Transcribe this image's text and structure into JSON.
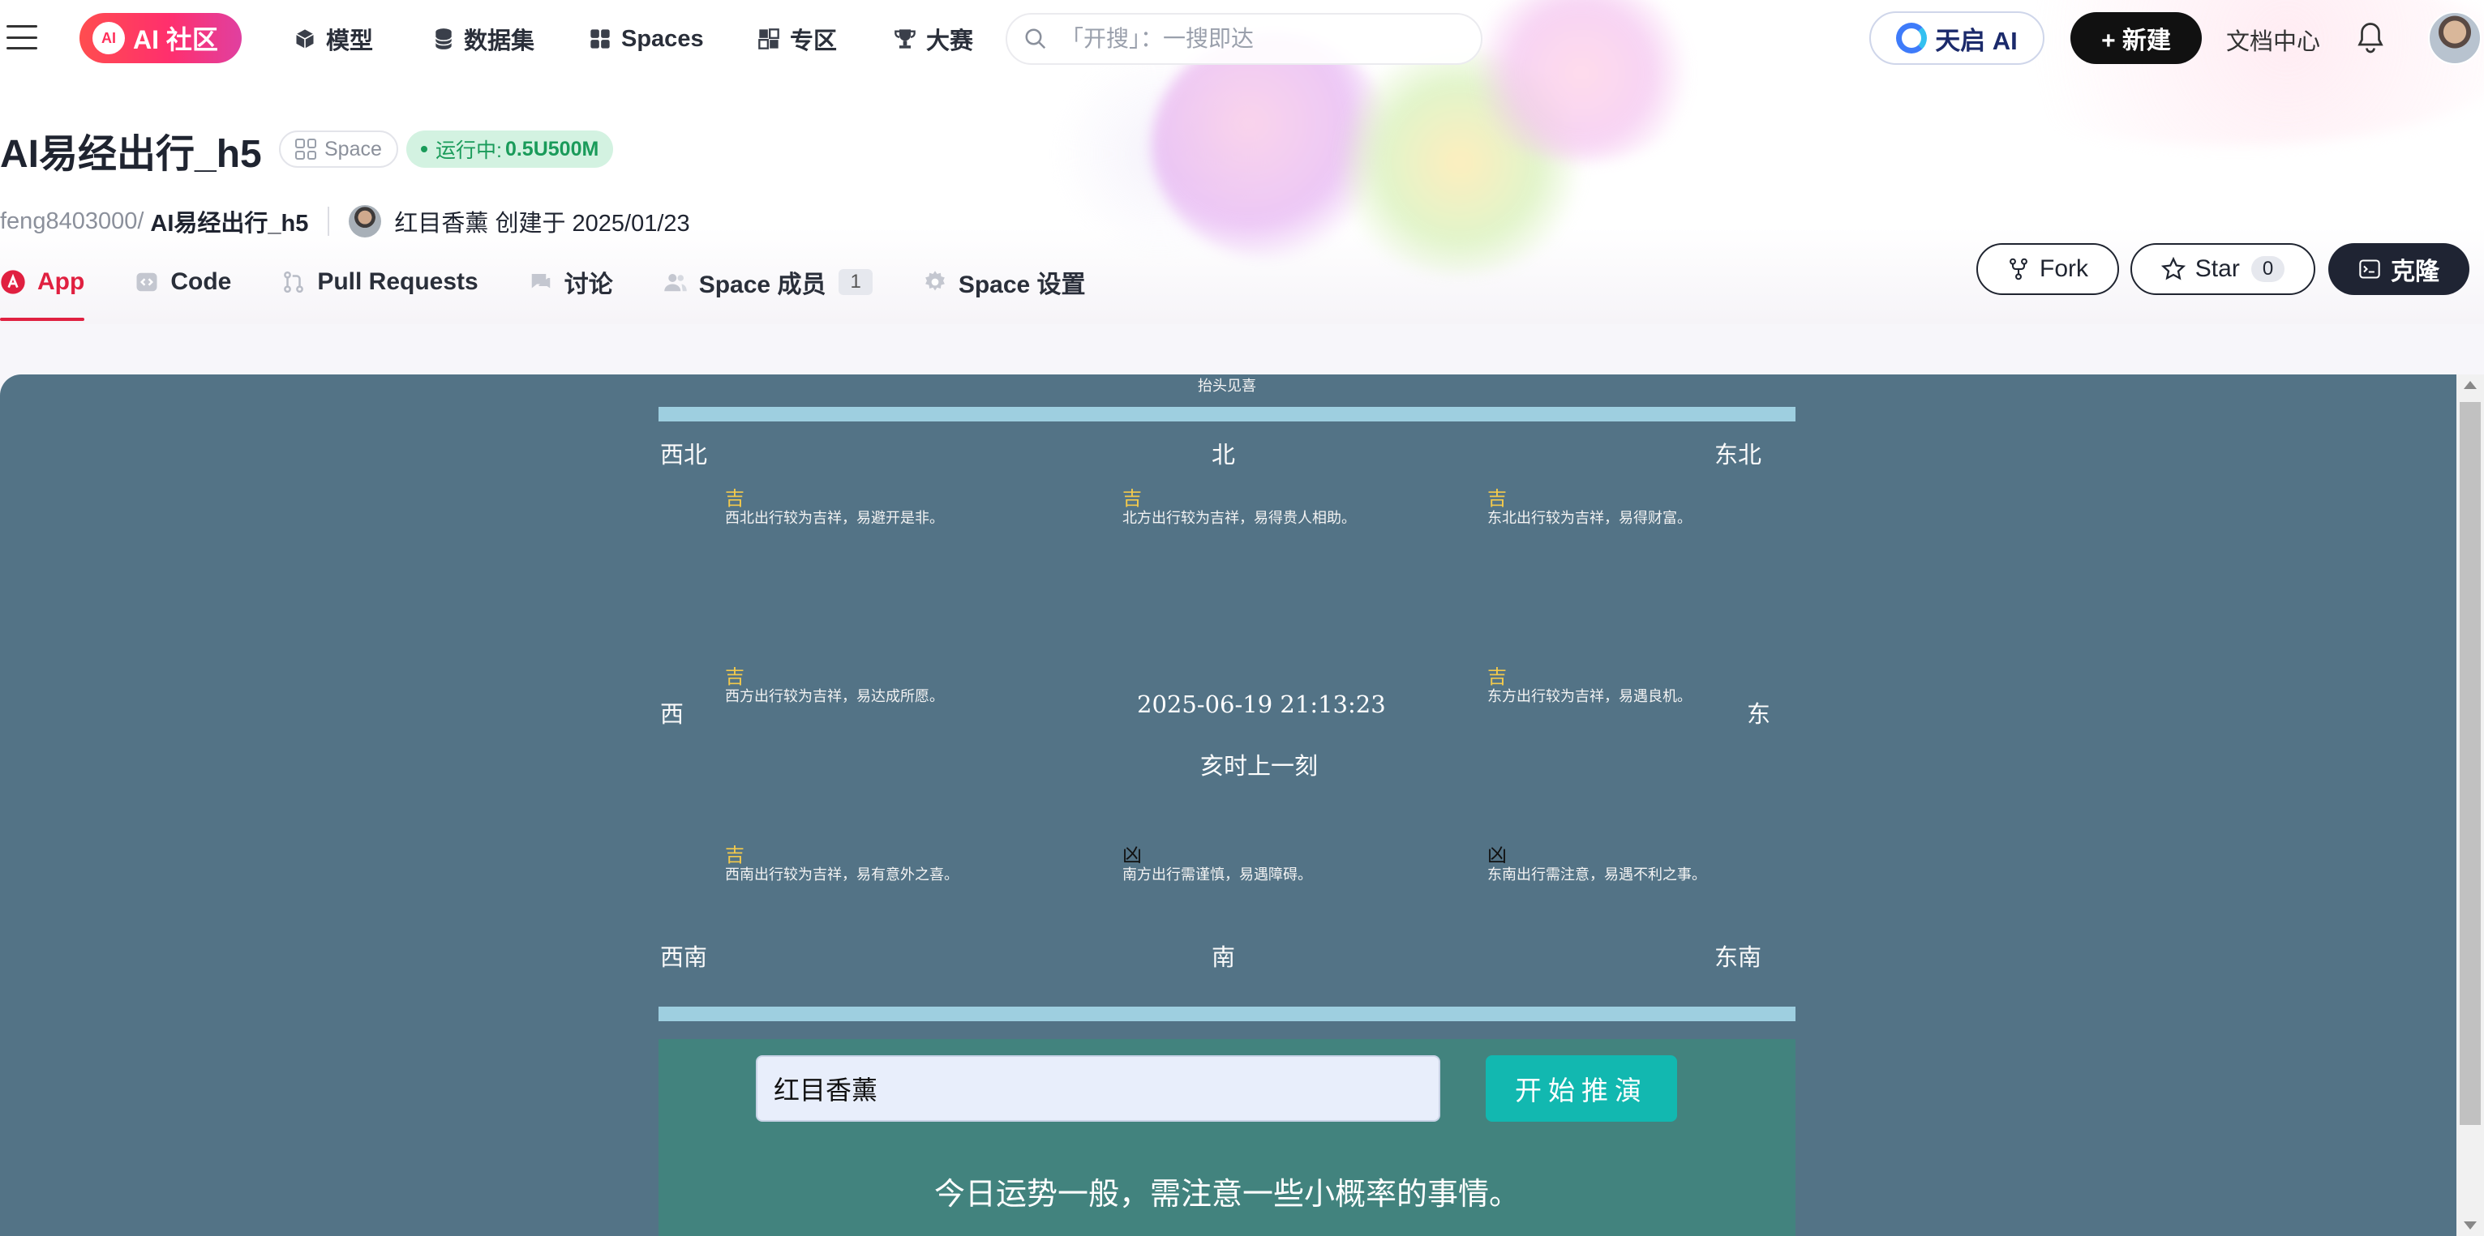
{
  "nav": {
    "logo_label": "AI 社区",
    "logo_mark": "AI",
    "items": [
      {
        "label": "模型",
        "icon": "cube-icon"
      },
      {
        "label": "数据集",
        "icon": "database-icon"
      },
      {
        "label": "Spaces",
        "icon": "spaces-grid-icon"
      },
      {
        "label": "专区",
        "icon": "zone-icon"
      },
      {
        "label": "大赛",
        "icon": "trophy-icon"
      }
    ],
    "search_placeholder": "「开搜」：一搜即达",
    "tianqi_label": "天启 AI",
    "new_label": "+ 新建",
    "docs_label": "文档中心"
  },
  "header": {
    "title": "AI易经出行_h5",
    "space_badge": "Space",
    "status_prefix": "运行中:",
    "status_value": "0.5U500M",
    "owner": "feng8403000/",
    "repo": "AI易经出行_h5",
    "author_line": "红目香薰 创建于 2025/01/23"
  },
  "tabs": [
    {
      "label": "App",
      "active": true
    },
    {
      "label": "Code"
    },
    {
      "label": "Pull Requests"
    },
    {
      "label": "讨论"
    },
    {
      "label": "Space 成员",
      "count": "1"
    },
    {
      "label": "Space 设置"
    }
  ],
  "actions": {
    "fork_label": "Fork",
    "star_label": "Star",
    "star_count": "0",
    "clone_label": "克隆"
  },
  "app": {
    "top_text": "抬头见喜",
    "directions": {
      "nw": "西北",
      "n": "北",
      "ne": "东北",
      "w": "西",
      "e": "东",
      "sw": "西南",
      "s": "南",
      "se": "东南"
    },
    "cells": {
      "nw": {
        "verdict": "吉",
        "text": "西北出行较为吉祥，易避开是非。"
      },
      "n": {
        "verdict": "吉",
        "text": "北方出行较为吉祥，易得贵人相助。"
      },
      "ne": {
        "verdict": "吉",
        "text": "东北出行较为吉祥，易得财富。"
      },
      "w": {
        "verdict": "吉",
        "text": "西方出行较为吉祥，易达成所愿。"
      },
      "e": {
        "verdict": "吉",
        "text": "东方出行较为吉祥，易遇良机。"
      },
      "sw": {
        "verdict": "吉",
        "text": "西南出行较为吉祥，易有意外之喜。"
      },
      "s": {
        "verdict": "凶",
        "text": "南方出行需谨慎，易遇障碍。"
      },
      "se": {
        "verdict": "凶",
        "text": "东南出行需注意，易遇不利之事。"
      }
    },
    "datetime": "2025-06-19 21:13:23",
    "shichen": "亥时上一刻",
    "name_value": "红目香薰",
    "start_label": "开始推演",
    "result": "今日运势一般，需注意一些小概率的事情。"
  },
  "colors": {
    "accent": "#e02040",
    "app_bg": "#537386",
    "panel_bg": "#42837e",
    "good": "#f2c94c",
    "bad": "#111111",
    "bar": "#9ecfe0",
    "start_btn": "#12b8b0"
  }
}
